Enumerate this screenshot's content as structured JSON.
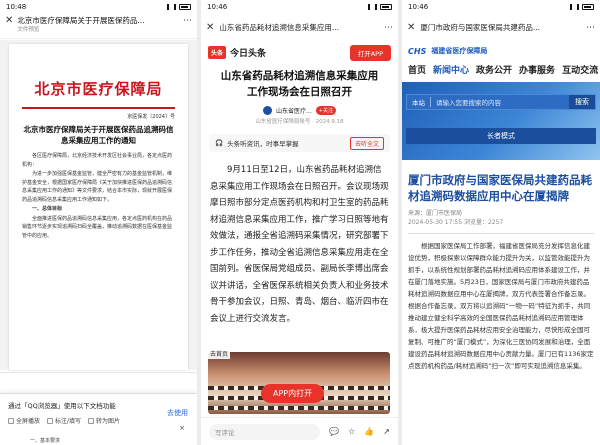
{
  "panel1": {
    "status_time": "10:48",
    "title": "北京市医疗保障局关于开展医保药品...",
    "subtitle": "文件预览",
    "doc_header": "北京市医疗保障局",
    "doc_number": "京医保发〔2024〕号",
    "doc_title": "北京市医疗保障局关于开展医保药品追溯码信息采集应用工作的通知",
    "doc_paragraphs": [
      "各区医疗保障局，北京经济技术开发区社会事业局，各定点医药机构：",
      "为进一步加强医保基金监管，健全严密有力的基金监管机制，维护基金安全，根据国家医疗保障局《关于加快推进医保药品追溯码信息采集应用工作的通知》等文件要求，结合本市实际，现就开展医保药品追溯码信息采集应用工作通知如下。",
      "一、总体目标",
      "全面推进医保药品追溯码信息采集应用，各定点医药机构在药品销售环节逐步实现追溯码扫码全覆盖，推动追溯码数据在医保基金监管中的应用。"
    ],
    "doc_footer_text": "一、基本要求",
    "sheet_text": "通过「QQ浏览器」使用以下文档功能",
    "sheet_use": "去使用",
    "sheet_options": [
      "全屏播放",
      "标注/填写",
      "转为图片"
    ],
    "sheet_close": "×"
  },
  "panel2": {
    "status_time": "10:46",
    "title": "山东省药品耗材追溯信息采集应用...",
    "brand_logo": "头条",
    "brand_name": "今日头条",
    "open_app": "打开APP",
    "headline": "山东省药品耗材追溯信息采集应用工作现场会在日照召开",
    "source_name": "山东省医疗...",
    "follow": "+关注",
    "meta": "山东省医疗保障局账号 · 2024.9.18",
    "promo_text": "头条听资讯，时事早掌握",
    "promo_action": "去听全文",
    "body": "9月11日至12日，山东省药品耗材追溯信息采集应用工作现场会在日照召开。会议现场观摩日照市部分定点医药机构和村卫生室的药品耗材追溯信息采集应用工作，推广学习日照等地有效做法，通报全省追溯码采集情况，研究部署下步工作任务，推动全省追溯信息采集应用走在全国前列。省医保局党组成员、副局长李博出席会议并讲话，全省医保系统相关负责人和业务技术骨干参加会议，日照、青岛、烟台、临沂四市在会议上进行交流发言。",
    "back_home": "去首页",
    "app_button": "APP内打开",
    "comment_placeholder": "写评论"
  },
  "panel3": {
    "status_time": "10:46",
    "title": "厦门市政府与国家医保局共建药品...",
    "logo_mark": "CHS",
    "logo_name": "福建省医疗保障局",
    "nav": [
      "首页",
      "新闻中心",
      "政务公开",
      "办事服务",
      "互动交流"
    ],
    "search_label": "本站",
    "search_placeholder": "请输入您要搜索的内容",
    "search_button": "搜索",
    "elder_mode": "长者模式",
    "headline": "厦门市政府与国家医保局共建药品耗材追溯码数据应用中心在厦揭牌",
    "meta_source": "来源：厦门市医保局",
    "meta_line": "2024-05-30 17:55   浏览量：2257",
    "body": "根据国家医保局工作部署，福建省医保局充分发挥信息化建设优势，积极探索以保障群众能力提升为关，以监管效能提升为抓手，以系统性规划部署药品耗材追溯码应用体系建设工作，并在厦门落地实施。5月23日，国家医保局与厦门市政府共建药品耗材追溯码数据应用中心在厦揭牌，双方代表签署合作备忘录。根据合作备忘录，双方将以追溯码“一物一码”特征为抓手，共同推动建立健全科学高效的全国医保药品耗材追溯码应用管理体系，极大提升医保药品耗材应用安全治理能力，尽快形成全国可复制、可推广的“厦门模式”，为深化三医协同发展和治理，全面建设药品耗材追溯码数据应用中心贡献力量。厦门已有1136家定点医药机构药品/耗材追溯码“扫一次”即可实现追溯信息采集。"
  }
}
